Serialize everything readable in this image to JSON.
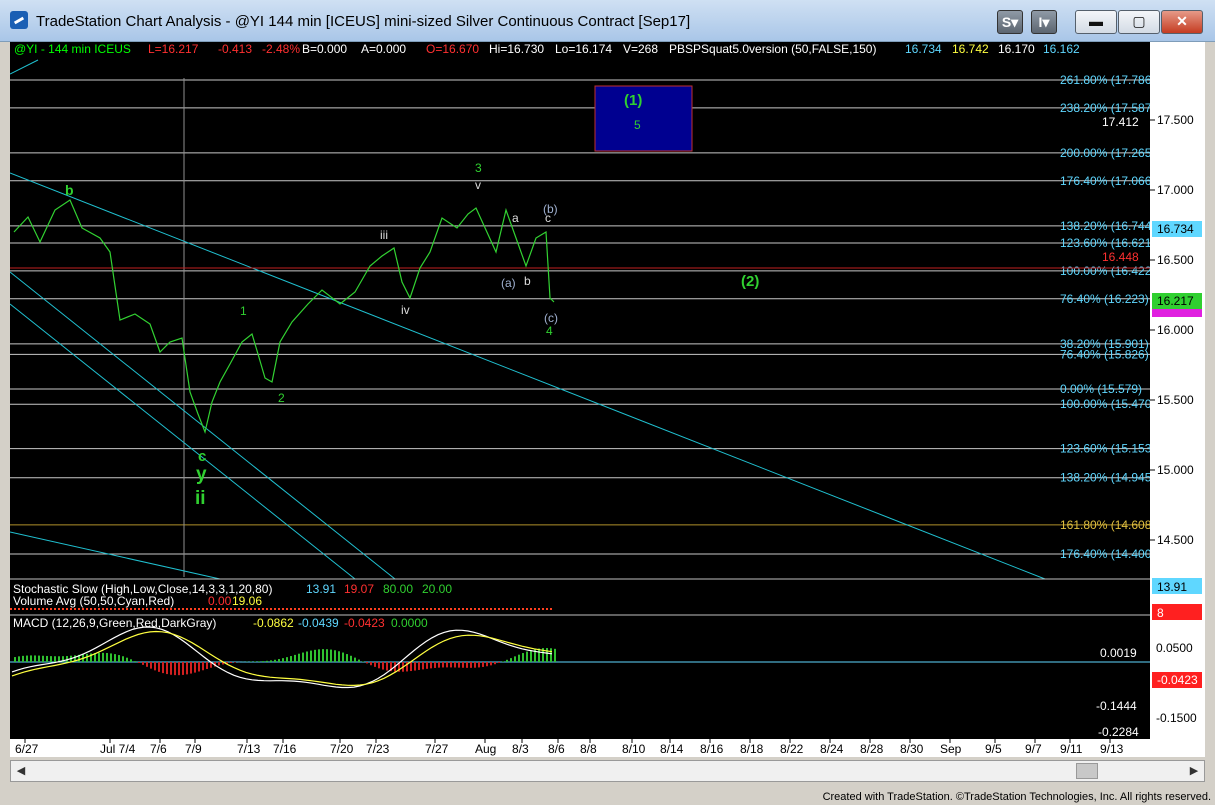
{
  "window": {
    "title": "TradeStation Chart Analysis - @YI 144 min [ICEUS] mini-sized Silver Continuous Contract [Sep17]",
    "buttons": {
      "s_menu": "S",
      "i_menu": "I",
      "minimize": "▬",
      "maximize": "▢",
      "close": "✕"
    }
  },
  "header_line": {
    "symbol": "@YI - 144 min  ICEUS",
    "last": "L=16.217",
    "change": "-0.413",
    "change_pct": "-2.48%",
    "bid": "B=0.000",
    "ask": "A=0.000",
    "open": "O=16.670",
    "high": "Hi=16.730",
    "low": "Lo=16.174",
    "volume": "V=268",
    "indicator": "PBSPSquat5.0version (50,FALSE,150)",
    "v1": "16.734",
    "v2": "16.742",
    "v3": "16.170",
    "v4": "16.162"
  },
  "price_axis": {
    "ticks": [
      "17.500",
      "17.000",
      "16.500",
      "16.000",
      "15.500",
      "15.000",
      "14.500"
    ],
    "last_price": "16.734",
    "current_price": "16.217",
    "box_value": "17.412"
  },
  "fib_labels": [
    {
      "text": "261.80% (17.786)",
      "price": 17.786
    },
    {
      "text": "238.20% (17.587)",
      "price": 17.587
    },
    {
      "text": "200.00% (17.265)",
      "price": 17.265
    },
    {
      "text": "176.40% (17.066)",
      "price": 17.066
    },
    {
      "text": "138.20% (16.744)",
      "price": 16.744
    },
    {
      "text": "123.60% (16.621)",
      "price": 16.621
    },
    {
      "text": "100.00% (16.422)",
      "price": 16.422
    },
    {
      "text": "76.40% (16.223)",
      "price": 16.223
    },
    {
      "text": "38.20% (15.901)",
      "price": 15.901
    },
    {
      "text": "76.40% (15.826)",
      "price": 15.826
    },
    {
      "text": "0.00% (15.579)",
      "price": 15.579
    },
    {
      "text": "100.00% (15.470)",
      "price": 15.47
    },
    {
      "text": "123.60% (15.153)",
      "price": 15.153
    },
    {
      "text": "138.20% (14.945)",
      "price": 14.945
    },
    {
      "text": "161.80% (14.608)",
      "price": 14.608
    },
    {
      "text": "176.40% (14.400)",
      "price": 14.4
    }
  ],
  "wave_labels": {
    "b_top": "b",
    "one": "1",
    "two": "2",
    "c": "c",
    "y": "y",
    "ii": "ii",
    "iii": "iii",
    "iv": "iv",
    "three": "3",
    "v": "v",
    "a": "a",
    "b_small": "b",
    "paren_a": "(a)",
    "paren_b": "(b)",
    "c_small": "c",
    "paren_c": "(c)",
    "four": "4",
    "wave_1": "(1)",
    "five": "5",
    "wave_2": "(2)",
    "red_level": "16.448"
  },
  "dates": [
    "6/27",
    "Jul 7/4",
    "7/6",
    "7/9",
    "7/13",
    "7/16",
    "7/20",
    "7/23",
    "7/27",
    "Aug",
    "8/3",
    "8/6",
    "8/8",
    "8/10",
    "8/14",
    "8/16",
    "8/18",
    "8/22",
    "8/24",
    "8/28",
    "8/30",
    "Sep",
    "9/5",
    "9/7",
    "9/11",
    "9/13"
  ],
  "stochastic": {
    "label": "Stochastic Slow (High,Low,Close,14,3,3,1,20,80)",
    "v1": "13.91",
    "v2": "19.07",
    "v3": "80.00",
    "v4": "20.00",
    "axis_value": "13.91",
    "overlap_label": "Volume Avg (50,50,Cyan,Red)",
    "overlap_v1": "0.00",
    "overlap_v2": "19.06",
    "axis_red": "8"
  },
  "macd": {
    "label": "MACD (12,26,9,Green,Red,DarkGray)",
    "v1": "-0.0862",
    "v2": "-0.0439",
    "v3": "-0.0423",
    "v4": "0.0000",
    "ticks": [
      "0.0500",
      "0.0019",
      "-0.1444",
      "-0.1500",
      "-0.2284"
    ],
    "current": "-0.0423"
  },
  "credit": "Created with TradeStation. ©TradeStation Technologies, Inc. All rights reserved."
}
